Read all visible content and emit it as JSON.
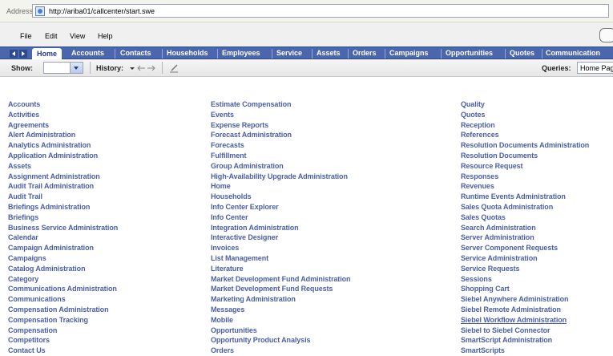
{
  "address": {
    "label": "Address",
    "url": "http://ariba01/callcenter/start.swe"
  },
  "menu": [
    "File",
    "Edit",
    "View",
    "Help"
  ],
  "tabs": [
    "Home",
    "Accounts",
    "Contacts",
    "Households",
    "Employees",
    "Service",
    "Assets",
    "Orders",
    "Campaigns",
    "Opportunities",
    "Quotes",
    "Communication"
  ],
  "toolbar": {
    "show_label": "Show:",
    "history_label": "History:",
    "queries_label": "Queries:",
    "queries_value": "Home Pag"
  },
  "columns": [
    [
      "Accounts",
      "Activities",
      "Agreements",
      "Alert Administration",
      "Analytics Administration",
      "Application Administration",
      "Assets",
      "Assignment Administration",
      "Audit Trail Administration",
      "Audit Trail",
      "Briefings Administration",
      "Briefings",
      "Business Service Administration",
      "Calendar",
      "Campaign Administration",
      "Campaigns",
      "Catalog Administration",
      "Category",
      "Communications Administration",
      "Communications",
      "Compensation Administration",
      "Compensation Tracking",
      "Compensation",
      "Competitors",
      "Contact Us"
    ],
    [
      "Estimate Compensation",
      "Events",
      "Expense Reports",
      "Forecast Administration",
      "Forecasts",
      "Fulfillment",
      "Group Administration",
      "High-Availability Upgrade Administration",
      "Home",
      "Households",
      "Info Center Explorer",
      "Info Center",
      "Integration Administration",
      "Interactive Designer",
      "Invoices",
      "List Management",
      "Literature",
      "Market Development Fund Administration",
      "Market Development Fund Requests",
      "Marketing Administration",
      "Messages",
      "Mobile",
      "Opportunities",
      "Opportunity Product Analysis",
      "Orders"
    ],
    [
      "Quality",
      "Quotes",
      "Reception",
      "References",
      "Resolution Documents Administration",
      "Resolution Documents",
      "Resource Request",
      "Responses",
      "Revenues",
      "Runtime Events Administration",
      "Sales Quota Administration",
      "Sales Quotas",
      "Search Administration",
      "Server Administration",
      "Server Component Requests",
      "Service Administration",
      "Service Requests",
      "Sessions",
      "Shopping Cart",
      "Siebel Anywhere Administration",
      "Siebel Remote Administration",
      "Siebel Workflow Administration",
      "Siebel to Siebel Connector",
      "SmartScript Administration",
      "SmartScripts"
    ]
  ],
  "hovered_link": "Siebel Workflow Administration"
}
